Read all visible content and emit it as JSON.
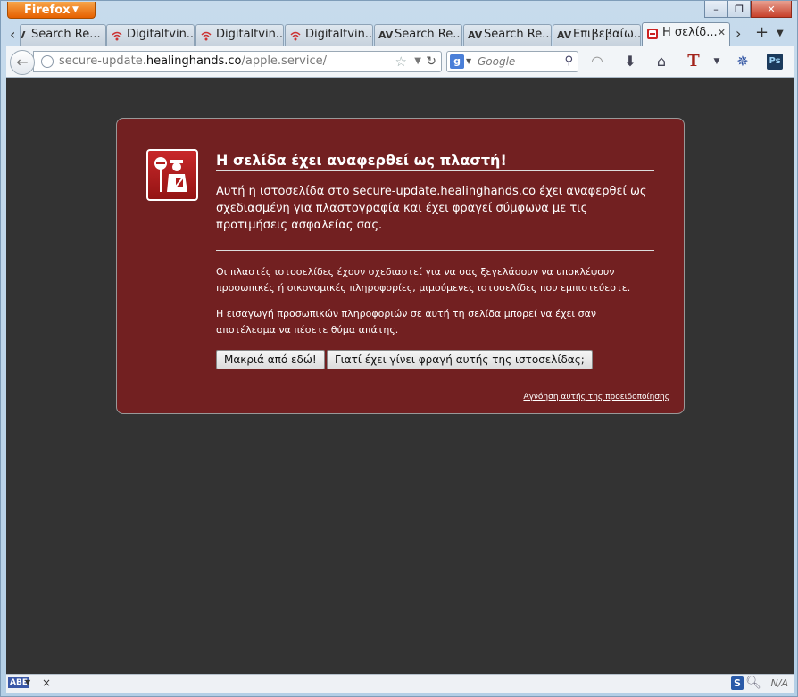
{
  "browser": {
    "menu_button": "Firefox",
    "window_controls": {
      "minimize": "–",
      "restore": "❐",
      "close": "✕"
    }
  },
  "tabs": [
    {
      "label": "Search Re...",
      "icon": "AV"
    },
    {
      "label": "Digitaltvin...",
      "icon": "wifi-icon"
    },
    {
      "label": "Digitaltvin...",
      "icon": "wifi-icon"
    },
    {
      "label": "Digitaltvin...",
      "icon": "wifi-icon"
    },
    {
      "label": "Search Re...",
      "icon": "AV"
    },
    {
      "label": "Search Re...",
      "icon": "AV"
    },
    {
      "label": "Επιβεβαίω...",
      "icon": "AV"
    },
    {
      "label": "Η σελίδ...",
      "icon": "blocked-icon",
      "selected": true
    }
  ],
  "navbar": {
    "url_prefix": "secure-update.",
    "url_domain": "healinghands.co",
    "url_path": "/apple.service/",
    "search_placeholder": "Google"
  },
  "error_page": {
    "title": "Η σελίδα έχει αναφερθεί ως πλαστή!",
    "short_desc": "Αυτή η ιστοσελίδα στο secure-update.healinghands.co έχει αναφερθεί ως σχεδιασμένη για πλαστογραφία και έχει φραγεί σύμφωνα με τις προτιμήσεις ασφαλείας σας.",
    "long_desc_1": "Οι πλαστές ιστοσελίδες έχουν σχεδιαστεί για να σας ξεγελάσουν να υποκλέψουν προσωπικές ή οικονομικές πληροφορίες, μιμούμενες ιστοσελίδες που εμπιστεύεστε.",
    "long_desc_2": "Η εισαγωγή προσωπικών πληροφοριών σε αυτή τη σελίδα μπορεί να έχει σαν αποτέλεσμα να πέσετε θύμα απάτης.",
    "get_me_out_button": "Μακριά από εδώ!",
    "why_blocked_button": "Γιατί έχει γίνει φραγή αυτής της ιστοσελίδας;",
    "ignore_link": "Αγνόηση αυτής της προειδοποίησης"
  },
  "statusbar": {
    "abe_label": "ABE",
    "close_label": "×",
    "s_label": "S",
    "na_label": "N/A"
  }
}
